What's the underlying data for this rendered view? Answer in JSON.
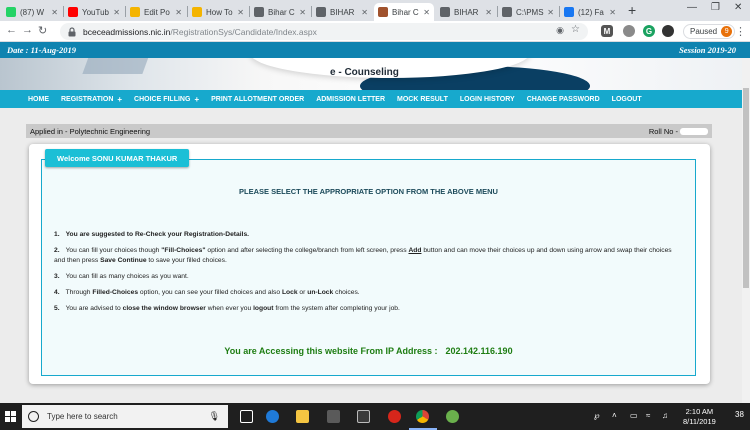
{
  "browser": {
    "tabs": [
      {
        "title": "(87) W",
        "favicon_color": "#25d366",
        "active": false
      },
      {
        "title": "YouTub",
        "favicon_color": "#ff0000",
        "active": false
      },
      {
        "title": "Edit Po",
        "favicon_color": "#f4b400",
        "active": false
      },
      {
        "title": "How To",
        "favicon_color": "#f4b400",
        "active": false
      },
      {
        "title": "Bihar C",
        "favicon_color": "#5f6368",
        "active": false
      },
      {
        "title": "BIHAR",
        "favicon_color": "#5f6368",
        "active": false
      },
      {
        "title": "Bihar C",
        "favicon_color": "#a0522d",
        "active": true
      },
      {
        "title": "BIHAR",
        "favicon_color": "#5f6368",
        "active": false
      },
      {
        "title": "C:\\PMS",
        "favicon_color": "#5f6368",
        "active": false
      },
      {
        "title": "(12) Fa",
        "favicon_color": "#1877f2",
        "active": false
      }
    ],
    "new_tab_label": "+",
    "url_host": "bceceadmissions.nic.in",
    "url_path": "/RegistrationSys/Candidate/Index.aspx",
    "paused_label": "Paused",
    "avatar_letter": "9"
  },
  "header": {
    "date_text": "Date : 11-Aug-2019",
    "session_text": "Session 2019-20",
    "banner_title": "e - Counseling"
  },
  "menu": [
    {
      "label": "HOME",
      "has_plus": false
    },
    {
      "label": "REGISTRATION",
      "has_plus": true
    },
    {
      "label": "CHOICE FILLING",
      "has_plus": true
    },
    {
      "label": "PRINT ALLOTMENT ORDER",
      "has_plus": false
    },
    {
      "label": "ADMISSION LETTER",
      "has_plus": false
    },
    {
      "label": "MOCK RESULT",
      "has_plus": false
    },
    {
      "label": "LOGIN HISTORY",
      "has_plus": false
    },
    {
      "label": "CHANGE PASSWORD",
      "has_plus": false
    },
    {
      "label": "LOGOUT",
      "has_plus": false
    }
  ],
  "applied": {
    "left_text": "Applied in - Polytechnic Engineering",
    "right_text": "Roll No -"
  },
  "panel": {
    "welcome": "Welcome SONU KUMAR THAKUR",
    "select_message": "PLEASE SELECT THE APPROPRIATE OPTION FROM THE ABOVE MENU",
    "ip_label": "You are Accessing this website From IP Address :",
    "ip_address": "202.142.116.190"
  },
  "instructions": [
    {
      "n": "1.",
      "parts": [
        {
          "t": "You are suggested to Re-Check your Registration-Details.",
          "b": true
        }
      ]
    },
    {
      "n": "2.",
      "parts": [
        {
          "t": "You can fill your choices though ",
          "b": false
        },
        {
          "t": "\"Fill-Choices\"",
          "b": true
        },
        {
          "t": " option and after selecting the college/branch from left screen, press ",
          "b": false
        },
        {
          "t": "Add",
          "b": true,
          "u": true
        },
        {
          "t": " button and can move their choices up and down using arrow and swap their choices and then press ",
          "b": false
        },
        {
          "t": "Save Continue",
          "b": true
        },
        {
          "t": " to save your filled choices.",
          "b": false
        }
      ]
    },
    {
      "n": "3.",
      "parts": [
        {
          "t": "You can fill as many choices as you want.",
          "b": false
        }
      ]
    },
    {
      "n": "4.",
      "parts": [
        {
          "t": "Through ",
          "b": false
        },
        {
          "t": "Filled-Choices",
          "b": true
        },
        {
          "t": " option, you can see your filled choices and also ",
          "b": false
        },
        {
          "t": "Lock",
          "b": true
        },
        {
          "t": " or ",
          "b": false
        },
        {
          "t": "un-Lock",
          "b": true
        },
        {
          "t": " choices.",
          "b": false
        }
      ]
    },
    {
      "n": "5.",
      "parts": [
        {
          "t": "You are advised to ",
          "b": false
        },
        {
          "t": "close the window browser",
          "b": true
        },
        {
          "t": " when ever you ",
          "b": false
        },
        {
          "t": "logout",
          "b": true
        },
        {
          "t": " from the system after completing your job.",
          "b": false
        }
      ]
    }
  ],
  "taskbar": {
    "search_placeholder": "Type here to search",
    "time": "2:10 AM",
    "date": "8/11/2019",
    "notification_count": "38"
  }
}
